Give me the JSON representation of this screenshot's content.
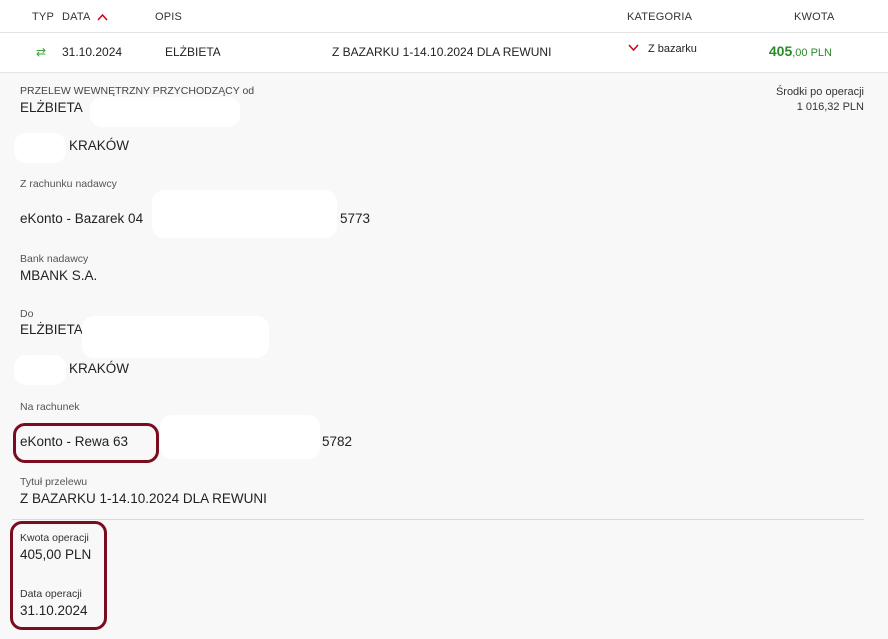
{
  "header": {
    "col_type": "TYP",
    "col_date": "DATA",
    "col_desc": "OPIS",
    "col_category": "KATEGORIA",
    "col_amount": "KWOTA"
  },
  "transaction": {
    "date": "31.10.2024",
    "desc_name": "ELŻBIETA",
    "desc_title": "Z BAZARKU 1-14.10.2024 DLA REWUNI",
    "category": "Z bazarku",
    "amount_int": "405",
    "amount_dec": ",00 PLN",
    "amount_color": "#2a8a2a"
  },
  "details": {
    "transfer_type": "PRZELEW WEWNĘTRZNY PRZYCHODZĄCY od",
    "sender_name": "ELŻBIETA",
    "sender_city": "KRAKÓW",
    "balance_label": "Środki po operacji",
    "balance_value": "1 016,32 PLN",
    "from_account_label": "Z rachunku nadawcy",
    "from_account_prefix": "eKonto - Bazarek 04",
    "from_account_suffix": "5773",
    "bank_label": "Bank nadawcy",
    "bank_value": "MBANK S.A.",
    "to_label": "Do",
    "to_name": "ELŻBIETA",
    "to_city": "KRAKÓW",
    "to_account_label": "Na rachunek",
    "to_account_prefix": "eKonto - Rewa 63",
    "to_account_suffix": "5782",
    "title_label": "Tytuł przelewu",
    "title_value": "Z BAZARKU 1-14.10.2024 DLA REWUNI",
    "op_amount_label": "Kwota operacji",
    "op_amount_value": "405,00 PLN",
    "op_date_label": "Data operacji",
    "op_date_value": "31.10.2024"
  },
  "colors": {
    "accent": "#d0021b",
    "highlight": "#7a0c1f",
    "positive": "#2a8a2a"
  }
}
